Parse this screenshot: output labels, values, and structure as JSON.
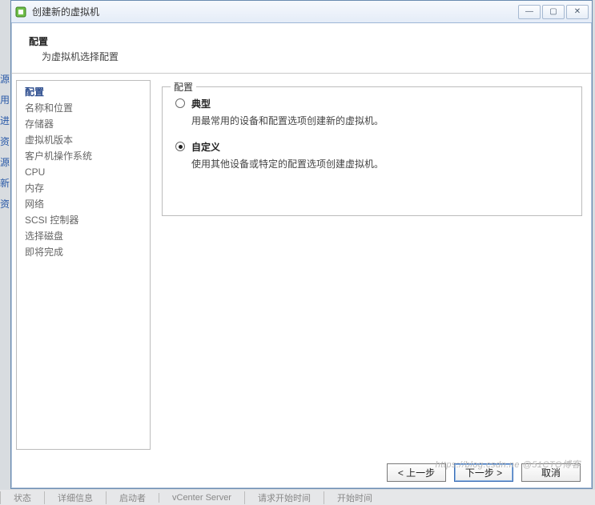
{
  "window": {
    "title": "创建新的虚拟机"
  },
  "header": {
    "title": "配置",
    "subtitle": "为虚拟机选择配置"
  },
  "sidebar": {
    "items": [
      "配置",
      "名称和位置",
      "存储器",
      "虚拟机版本",
      "客户机操作系统",
      "CPU",
      "内存",
      "网络",
      "SCSI 控制器",
      "选择磁盘",
      "即将完成"
    ],
    "active_index": 0
  },
  "content": {
    "group_label": "配置",
    "options": [
      {
        "label": "典型",
        "desc": "用最常用的设备和配置选项创建新的虚拟机。",
        "checked": false
      },
      {
        "label": "自定义",
        "desc": "使用其他设备或特定的配置选项创建虚拟机。",
        "checked": true
      }
    ]
  },
  "footer": {
    "back": "< 上一步",
    "next": "下一步 >",
    "cancel": "取消"
  },
  "left_gutter": [
    "源",
    "用",
    "进",
    "资",
    " ",
    "源:",
    " ",
    " ",
    " ",
    "新",
    "资"
  ],
  "bottom_strip": [
    "状态",
    "详细信息",
    "启动者",
    "vCenter Server",
    "请求开始时间",
    "开始时间"
  ],
  "watermark": "https://blog.csdn.ne @51CTO博客"
}
